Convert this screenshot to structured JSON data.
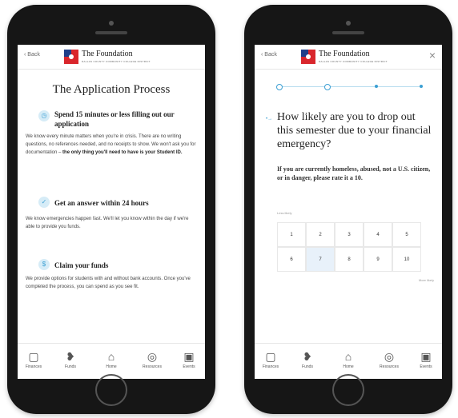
{
  "common": {
    "back_label": "Back",
    "brand_name": "The Foundation",
    "brand_subtitle": "DALLAS COUNTY COMMUNITY COLLEGE DISTRICT",
    "tabs": [
      {
        "label": "Finances",
        "icon": "wallet-icon",
        "glyph": "▢"
      },
      {
        "label": "Funds",
        "icon": "funds-icon",
        "glyph": "❥"
      },
      {
        "label": "Home",
        "icon": "home-icon",
        "glyph": "⌂"
      },
      {
        "label": "Resources",
        "icon": "resources-icon",
        "glyph": "◎"
      },
      {
        "label": "Events",
        "icon": "calendar-icon",
        "glyph": "▣"
      }
    ]
  },
  "left": {
    "title": "The Application Process",
    "steps": [
      {
        "title": "Spend 15 minutes or less filling out our application",
        "body": "We know every minute matters when you're in crisis. There are no writing questions, no references needed, and no receipts to show. We won't ask you for documentation –",
        "body_bold": "the only thing you'll need to have is your Student ID."
      },
      {
        "title": "Get an answer within 24 hours",
        "body": "We know emergencies happen fast. We'll let you know within the day if we're able to provide you funds."
      },
      {
        "title": "Claim your funds",
        "body": "We provide options for students with and without bank accounts. Once you've completed the process, you can spend as you see fit."
      }
    ]
  },
  "right": {
    "close_glyph": "×",
    "question": "How likely are you to drop out this semester due to your financial emergency?",
    "note": "If you are currently homeless, abused, not a U.S. citizen, or in danger, please rate it a 10.",
    "scale_low": "Less likely",
    "scale_high": "More likely",
    "options": [
      "1",
      "2",
      "3",
      "4",
      "5",
      "6",
      "7",
      "8",
      "9",
      "10"
    ],
    "selected": "7"
  }
}
